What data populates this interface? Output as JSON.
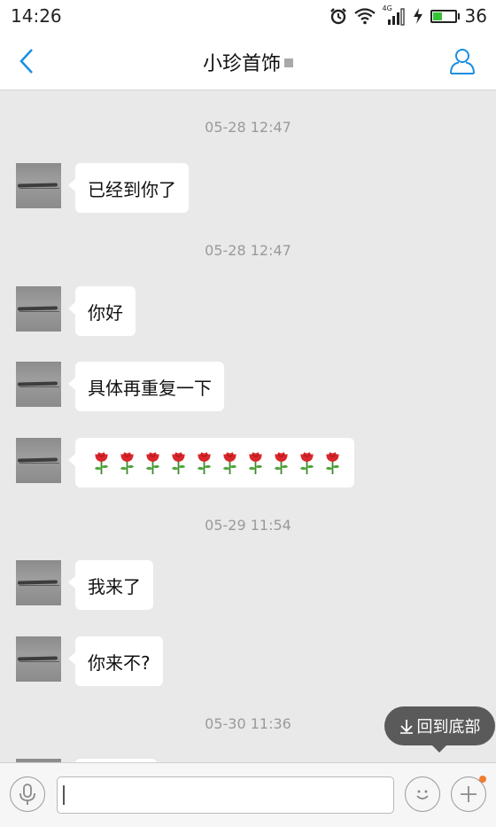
{
  "status_bar": {
    "time": "14:26",
    "network_label": "4G",
    "battery_level": 0.45,
    "battery_text": "36",
    "icons": [
      "alarm-icon",
      "wifi-icon",
      "cell-signal-icon",
      "charging-icon",
      "battery-icon"
    ]
  },
  "nav": {
    "title": "小珍首饰",
    "back_icon": "chevron-left-icon",
    "profile_icon": "person-icon",
    "accent_color": "#1a8fe0"
  },
  "messages": {
    "ts1": "05-28 12:47",
    "m1": "已经到你了",
    "ts2": "05-28 12:47",
    "m2": "你好",
    "m3": "具体再重复一下",
    "m4_roses": 10,
    "ts3": "05-29 11:54",
    "m5": "我来了",
    "m6": "你来不?",
    "ts4": "05-30 11:36"
  },
  "scroll_button": {
    "label": "回到底部",
    "icon": "arrow-down-icon"
  },
  "input_bar": {
    "message_value": "",
    "voice_icon": "microphone-icon",
    "emoji_icon": "smiley-icon",
    "plus_icon": "plus-icon",
    "badge_color": "#f07d2e"
  }
}
